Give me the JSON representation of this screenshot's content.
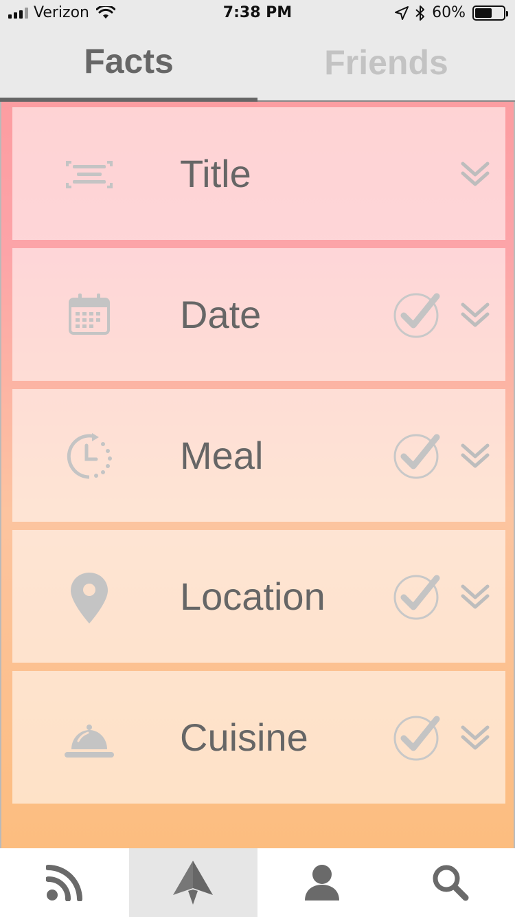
{
  "status_bar": {
    "carrier": "Verizon",
    "time": "7:38 PM",
    "battery": "60%",
    "battery_level": 0.6
  },
  "tabs": [
    {
      "label": "Facts",
      "active": true
    },
    {
      "label": "Friends",
      "active": false
    }
  ],
  "facts": [
    {
      "label": "Title",
      "icon": "title-lines-icon",
      "checked": false
    },
    {
      "label": "Date",
      "icon": "calendar-icon",
      "checked": true
    },
    {
      "label": "Meal",
      "icon": "clock-icon",
      "checked": true
    },
    {
      "label": "Location",
      "icon": "map-pin-icon",
      "checked": true
    },
    {
      "label": "Cuisine",
      "icon": "cloche-icon",
      "checked": true
    }
  ],
  "bottom_nav": [
    {
      "name": "feed",
      "icon": "rss-icon",
      "active": false
    },
    {
      "name": "send",
      "icon": "paper-plane-icon",
      "active": true
    },
    {
      "name": "profile",
      "icon": "user-icon",
      "active": false
    },
    {
      "name": "search",
      "icon": "search-icon",
      "active": false
    }
  ],
  "colors": {
    "gradient_top": "#fc9da1",
    "gradient_bottom": "#fcbd7f",
    "icon_gray": "#c4c4c4",
    "text_gray": "#666666"
  }
}
